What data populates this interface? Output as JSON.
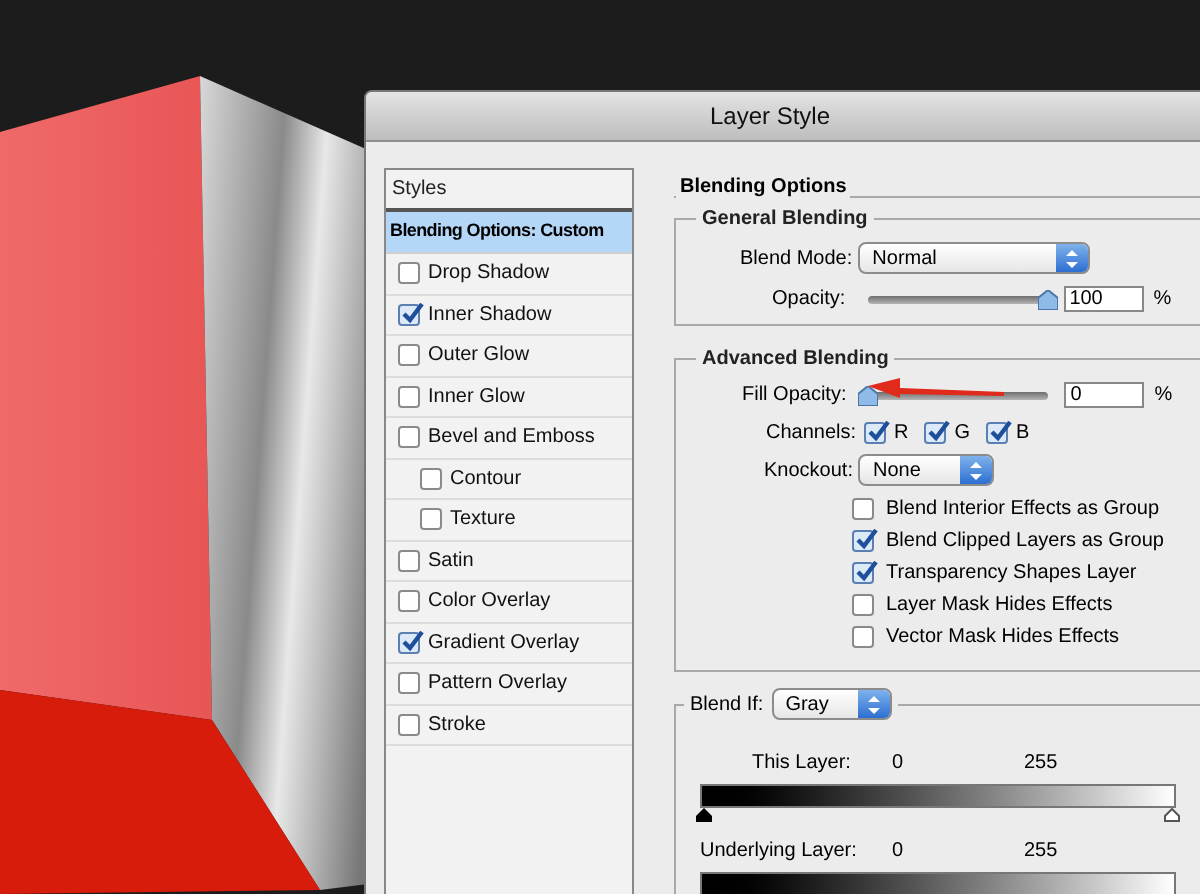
{
  "window": {
    "title": "Layer Style"
  },
  "styles": {
    "heading": "Styles",
    "items": [
      {
        "kind": "option",
        "label": "Blending Options: Custom",
        "selected": true
      },
      {
        "kind": "effect",
        "label": "Drop Shadow",
        "checked": false,
        "selected": false
      },
      {
        "kind": "effect",
        "label": "Inner Shadow",
        "checked": true,
        "selected": false
      },
      {
        "kind": "effect",
        "label": "Outer Glow",
        "checked": false,
        "selected": false
      },
      {
        "kind": "effect",
        "label": "Inner Glow",
        "checked": false,
        "selected": false
      },
      {
        "kind": "effect",
        "label": "Bevel and Emboss",
        "checked": false,
        "selected": false,
        "children": [
          {
            "kind": "effect",
            "label": "Contour",
            "checked": false,
            "selected": false
          },
          {
            "kind": "effect",
            "label": "Texture",
            "checked": false,
            "selected": false
          }
        ]
      },
      {
        "kind": "effect",
        "label": "Satin",
        "checked": false,
        "selected": false
      },
      {
        "kind": "effect",
        "label": "Color Overlay",
        "checked": false,
        "selected": false
      },
      {
        "kind": "effect",
        "label": "Gradient Overlay",
        "checked": true,
        "selected": false
      },
      {
        "kind": "effect",
        "label": "Pattern Overlay",
        "checked": false,
        "selected": false
      },
      {
        "kind": "effect",
        "label": "Stroke",
        "checked": false,
        "selected": false
      }
    ]
  },
  "blending_options": {
    "title": "Blending Options",
    "general": {
      "title": "General Blending",
      "blend_mode": {
        "label": "Blend Mode:",
        "value": "Normal"
      },
      "opacity": {
        "label": "Opacity:",
        "level": 1,
        "value": "100",
        "unit": "%"
      }
    },
    "advanced": {
      "title": "Advanced Blending",
      "fill_opacity": {
        "label": "Fill Opacity:",
        "level": 0,
        "value": "0",
        "unit": "%"
      },
      "channels": {
        "label": "Channels:",
        "items": [
          {
            "label": "R",
            "checked": true
          },
          {
            "label": "G",
            "checked": true
          },
          {
            "label": "B",
            "checked": true
          }
        ]
      },
      "knockout": {
        "label": "Knockout:",
        "value": "None"
      },
      "options": [
        {
          "label": "Blend Interior Effects as Group",
          "checked": false
        },
        {
          "label": "Blend Clipped Layers as Group",
          "checked": true
        },
        {
          "label": "Transparency Shapes Layer",
          "checked": true
        },
        {
          "label": "Layer Mask Hides Effects",
          "checked": false
        },
        {
          "label": "Vector Mask Hides Effects",
          "checked": false
        }
      ]
    },
    "blend_if": {
      "label": "Blend If:",
      "value": "Gray",
      "layers": [
        {
          "label": "This Layer:",
          "low": "0",
          "high": "255"
        },
        {
          "label": "Underlying Layer:",
          "low": "0",
          "high": "255"
        }
      ]
    }
  }
}
